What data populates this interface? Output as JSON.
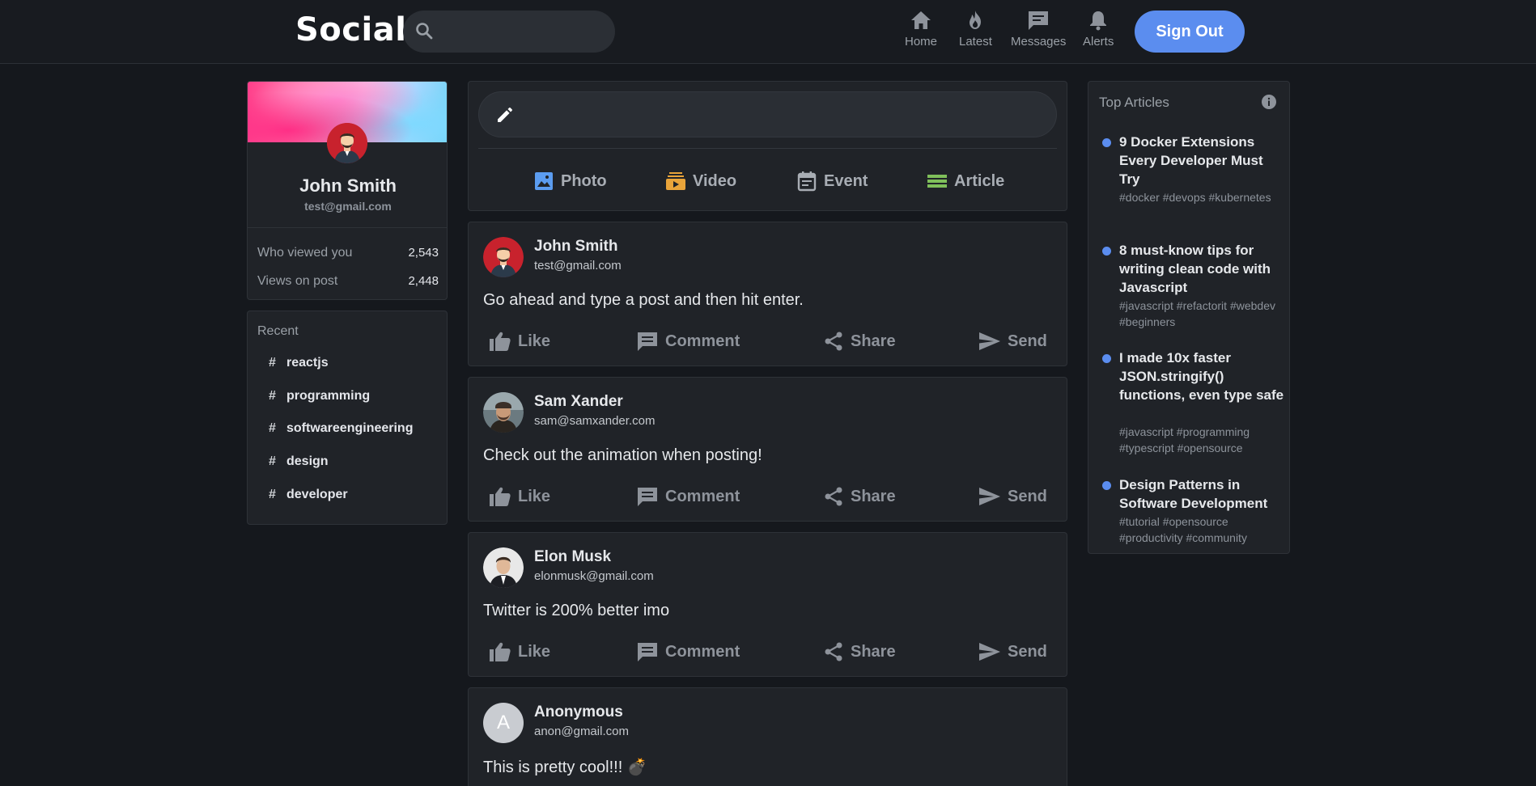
{
  "header": {
    "logo": "Social",
    "search": {
      "placeholder": "",
      "value": ""
    },
    "nav": [
      {
        "label": "Home",
        "icon": "home-icon"
      },
      {
        "label": "Latest",
        "icon": "fire-icon"
      },
      {
        "label": "Messages",
        "icon": "chat-icon"
      },
      {
        "label": "Alerts",
        "icon": "bell-icon"
      }
    ],
    "signout_label": "Sign Out"
  },
  "profile": {
    "name": "John Smith",
    "email": "test@gmail.com",
    "stats": [
      {
        "label": "Who viewed you",
        "value": "2,543"
      },
      {
        "label": "Views on post",
        "value": "2,448"
      }
    ]
  },
  "recent": {
    "title": "Recent",
    "items": [
      "reactjs",
      "programming",
      "softwareengineering",
      "design",
      "developer"
    ]
  },
  "compose": {
    "options": [
      {
        "label": "Photo",
        "icon": "photo-icon",
        "color": "#5b9cf0"
      },
      {
        "label": "Video",
        "icon": "video-icon",
        "color": "#e9a43a"
      },
      {
        "label": "Event",
        "icon": "calendar-icon",
        "color": "#a8adb4"
      },
      {
        "label": "Article",
        "icon": "article-icon",
        "color": "#7fbf5a"
      }
    ]
  },
  "posts": [
    {
      "author": "John Smith",
      "email": "test@gmail.com",
      "body": "Go ahead and type a post and then hit enter.",
      "avatar": "avatar-cartoon"
    },
    {
      "author": "Sam Xander",
      "email": "sam@samxander.com",
      "body": "Check out the animation when posting!",
      "avatar": "avatar-photo"
    },
    {
      "author": "Elon Musk",
      "email": "elonmusk@gmail.com",
      "body": "Twitter is 200% better imo",
      "avatar": "avatar-photo"
    },
    {
      "author": "Anonymous",
      "email": "anon@gmail.com",
      "body": "This is pretty cool!!! 💣",
      "avatar": "avatar-letter",
      "avatar_letter": "A"
    }
  ],
  "post_actions": [
    "Like",
    "Comment",
    "Share",
    "Send"
  ],
  "articles": {
    "title": "Top Articles",
    "items": [
      {
        "title": "9 Docker Extensions Every Developer Must Try",
        "tags": "#docker #devops #kubernetes"
      },
      {
        "title": "8 must-know tips for writing clean code with Javascript",
        "tags": "#javascript #refactorit #webdev #beginners"
      },
      {
        "title": "I made 10x faster JSON.stringify() functions, even type safe",
        "tags": "#javascript #programming #typescript #opensource"
      },
      {
        "title": "Design Patterns in Software Development",
        "tags": "#tutorial #opensource #productivity #community"
      }
    ]
  },
  "colors": {
    "accent": "#5b8def",
    "background": "#15181d",
    "card": "#202328"
  }
}
